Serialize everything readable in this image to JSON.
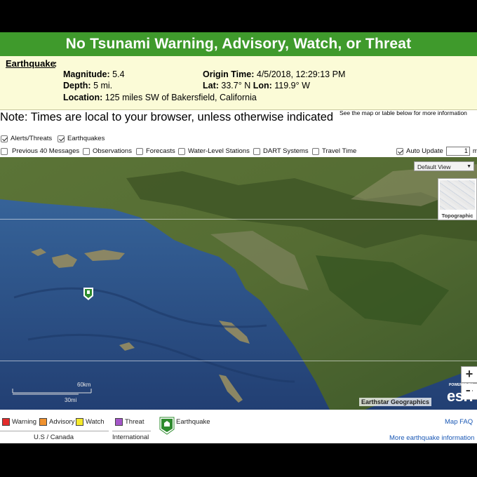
{
  "banner": {
    "title": "No Tsunami Warning, Advisory, Watch, or Threat",
    "color": "#3f9a2c"
  },
  "earthquake": {
    "label": "Earthquake",
    "magnitude_label": "Magnitude:",
    "magnitude": "5.4",
    "depth_label": "Depth:",
    "depth": "5 mi.",
    "location_label": "Location:",
    "location": "125 miles SW of Bakersfield, California",
    "origin_label": "Origin Time:",
    "origin": "4/5/2018, 12:29:13 PM",
    "lat_label": "Lat:",
    "lat": "33.7° N",
    "lon_label": "Lon:",
    "lon": "119.9° W"
  },
  "note": "Note: Times are local to your browser, unless otherwise indicated",
  "see_map": "See the map or table below for more information",
  "controls": {
    "alerts": {
      "label": "Alerts/Threats",
      "checked": true
    },
    "earthquakes": {
      "label": "Earthquakes",
      "checked": true
    },
    "previous": {
      "label": "Previous 40 Messages",
      "checked": false
    },
    "observations": {
      "label": "Observations",
      "checked": false
    },
    "forecasts": {
      "label": "Forecasts",
      "checked": false
    },
    "water_level": {
      "label": "Water-Level Stations",
      "checked": false
    },
    "dart": {
      "label": "DART Systems",
      "checked": false
    },
    "travel_time": {
      "label": "Travel Time",
      "checked": false
    },
    "auto_update": {
      "label": "Auto Update",
      "checked": true,
      "value": "1",
      "unit": "min"
    }
  },
  "map": {
    "default_view": "Default View",
    "basemap_thumb": "Topographic",
    "zoom_in": "+",
    "zoom_out": "−",
    "attribution": "Earthstar Geographics",
    "esri_powered": "POWERED BY",
    "esri": "esri",
    "scale_km": "60km",
    "scale_mi": "30mi",
    "ocean_color": "#2c5588",
    "land_color": "#4d6a2f"
  },
  "legend": {
    "warning": {
      "label": "Warning",
      "color": "#e32b2b"
    },
    "advisory": {
      "label": "Advisory",
      "color": "#f0922f"
    },
    "watch": {
      "label": "Watch",
      "color": "#f6ea2a"
    },
    "threat": {
      "label": "Threat",
      "color": "#a456c9"
    },
    "earthquake": "Earthquake",
    "us_canada": "U.S / Canada",
    "international": "International",
    "map_faq": "Map FAQ",
    "more_info": "More earthquake information"
  }
}
